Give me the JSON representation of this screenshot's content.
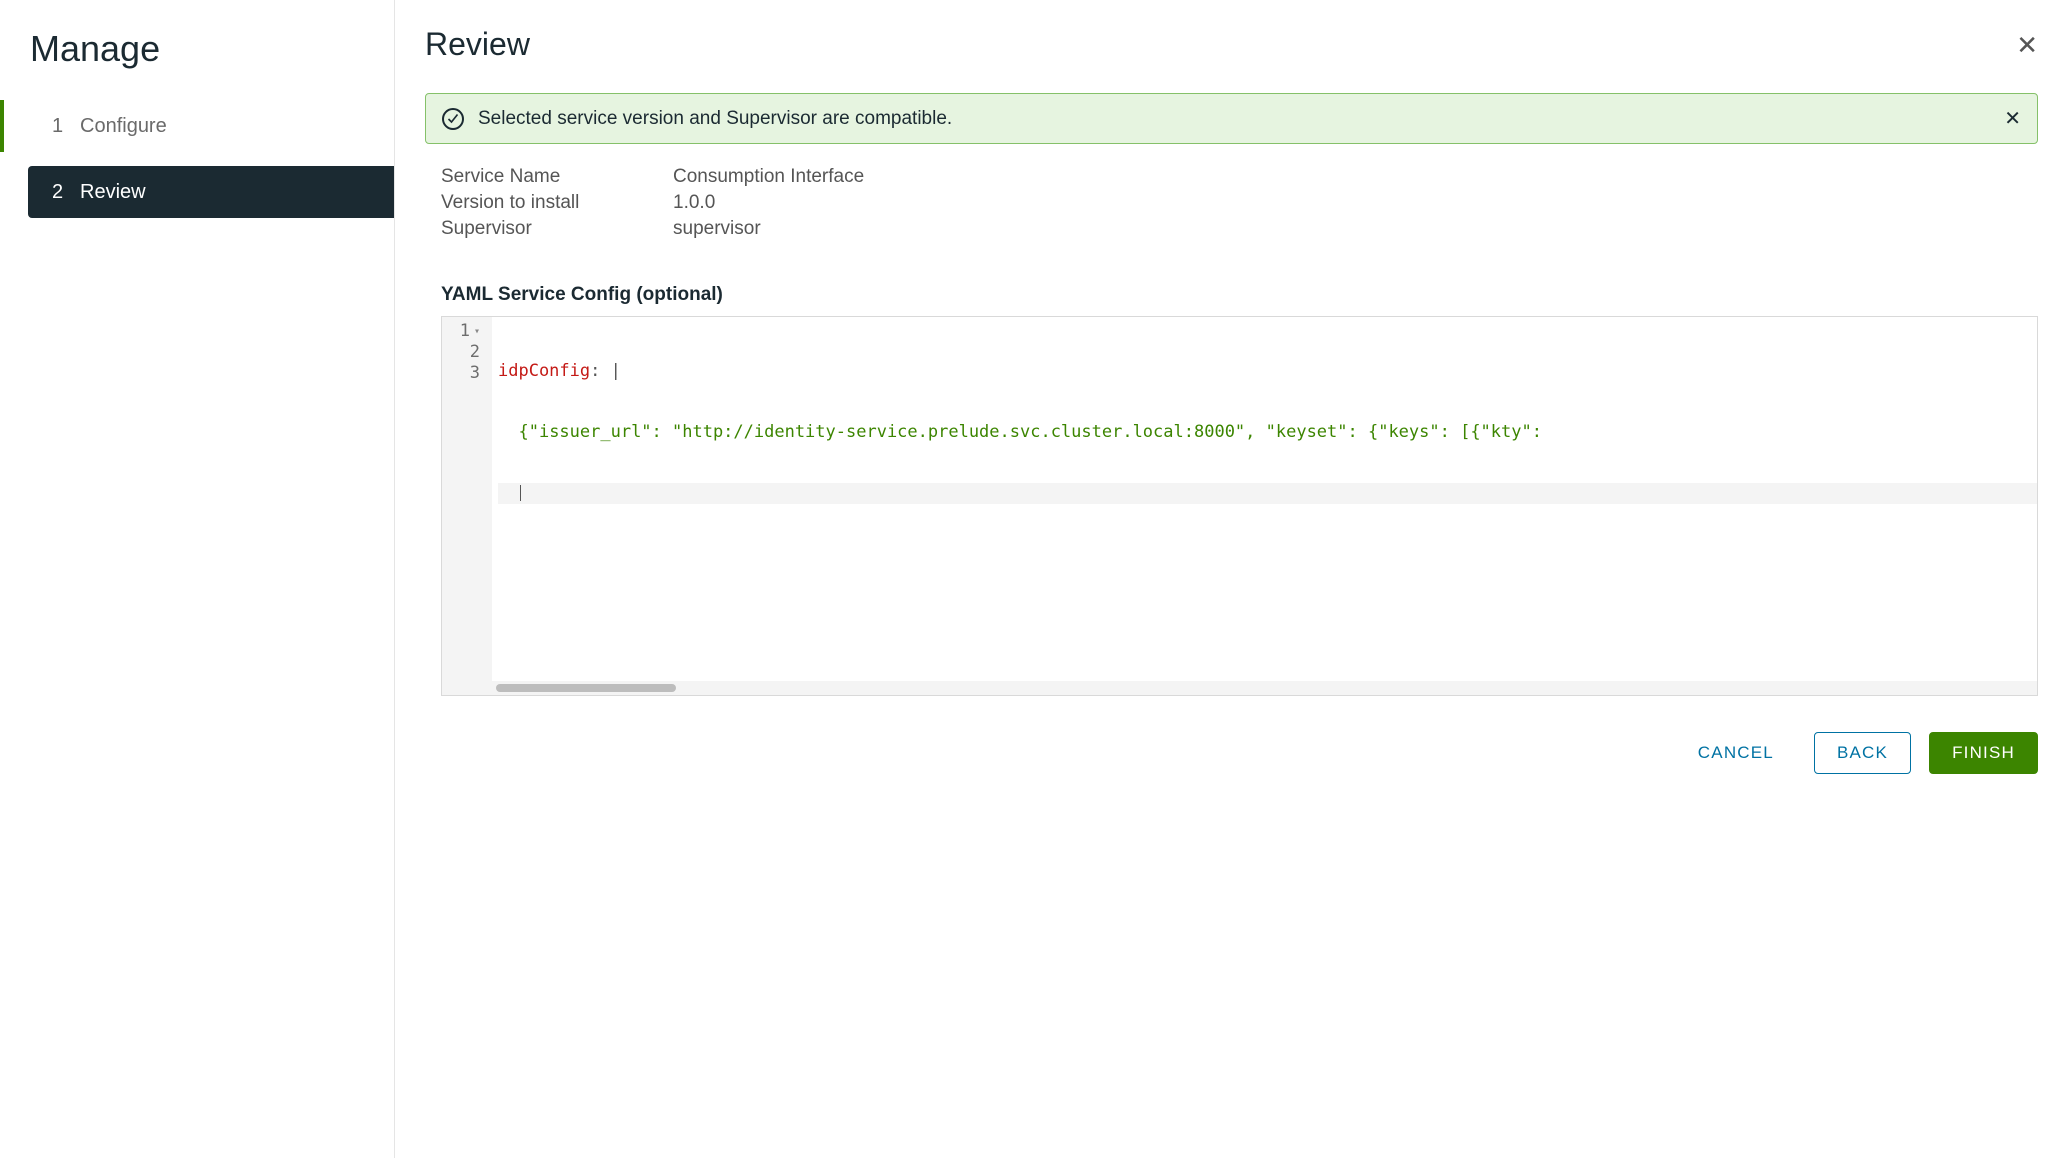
{
  "sidebar": {
    "title": "Manage",
    "steps": [
      {
        "num": "1",
        "label": "Configure",
        "active": false
      },
      {
        "num": "2",
        "label": "Review",
        "active": true
      }
    ]
  },
  "main": {
    "title": "Review",
    "alert": "Selected service version and Supervisor are compatible.",
    "fields": [
      {
        "label": "Service Name",
        "value": "Consumption Interface"
      },
      {
        "label": "Version to install",
        "value": "1.0.0"
      },
      {
        "label": "Supervisor",
        "value": "supervisor"
      }
    ],
    "yaml_label": "YAML Service Config (optional)",
    "yaml": {
      "line1_key": "idpConfig",
      "line1_rest": ": |",
      "line2_indent": "  ",
      "line2_str": "{\"issuer_url\": \"http://identity-service.prelude.svc.cluster.local:8000\", \"keyset\": {\"keys\": [{\"kty\":",
      "line_numbers": [
        "1",
        "2",
        "3"
      ]
    }
  },
  "footer": {
    "cancel": "CANCEL",
    "back": "BACK",
    "finish": "FINISH"
  }
}
